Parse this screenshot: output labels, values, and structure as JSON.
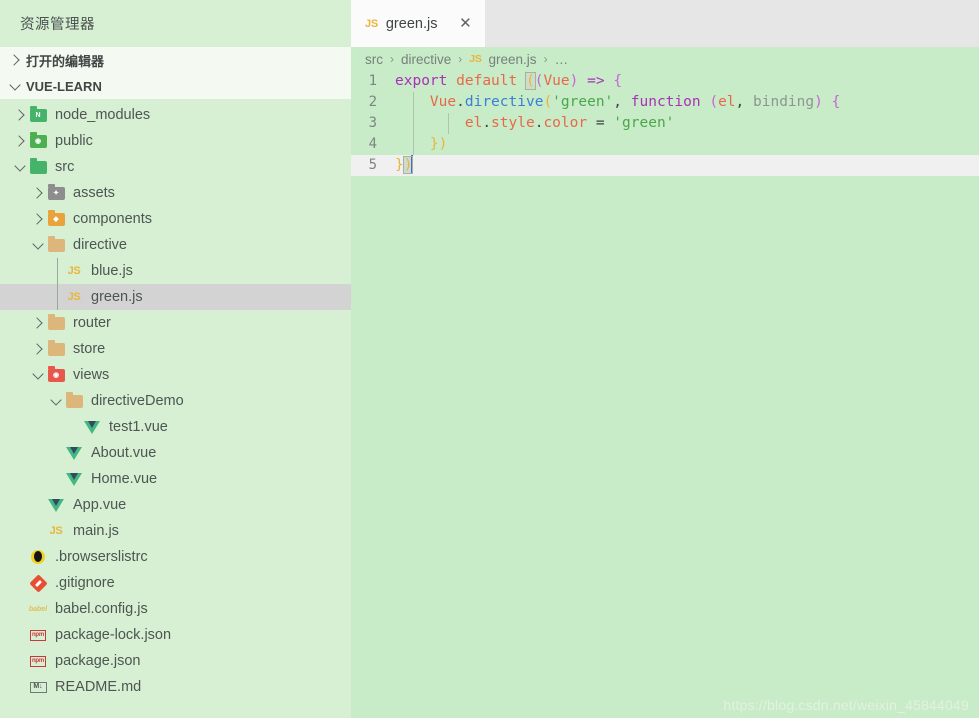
{
  "colors": {
    "editor_bg": "#c8ebc8",
    "sidebar_bg": "#d7efd3",
    "section_bg": "#f4faf2",
    "tabbar_bg": "#e6e6e6",
    "tab_active_bg": "#fbfbfb",
    "selection_bg": "#d3d3d3",
    "current_line_bg": "#f0f0f0",
    "cursor": "#4169e1",
    "watermark": "#e2f2e0"
  },
  "sidebar": {
    "title": "资源管理器",
    "sections": [
      {
        "label": "打开的编辑器",
        "expanded": false,
        "icon": "chevron-right-icon"
      },
      {
        "label": "VUE-LEARN",
        "expanded": true,
        "icon": "chevron-down-icon"
      }
    ],
    "tree": [
      {
        "label": "node_modules",
        "kind": "folder",
        "icon": "folder-node-icon",
        "twisty": "chevron-right-icon",
        "depth": 1,
        "selected": false
      },
      {
        "label": "public",
        "kind": "folder",
        "icon": "folder-public-icon",
        "twisty": "chevron-right-icon",
        "depth": 1,
        "selected": false
      },
      {
        "label": "src",
        "kind": "folder",
        "icon": "folder-src-icon",
        "twisty": "chevron-down-icon",
        "depth": 1,
        "selected": false
      },
      {
        "label": "assets",
        "kind": "folder",
        "icon": "folder-assets-icon",
        "twisty": "chevron-right-icon",
        "depth": 2,
        "selected": false
      },
      {
        "label": "components",
        "kind": "folder",
        "icon": "folder-components-icon",
        "twisty": "chevron-right-icon",
        "depth": 2,
        "selected": false
      },
      {
        "label": "directive",
        "kind": "folder",
        "icon": "folder-icon",
        "twisty": "chevron-down-icon",
        "depth": 2,
        "selected": false
      },
      {
        "label": "blue.js",
        "kind": "file",
        "icon": "js-file-icon",
        "twisty": "",
        "depth": 3,
        "selected": false
      },
      {
        "label": "green.js",
        "kind": "file",
        "icon": "js-file-icon",
        "twisty": "",
        "depth": 3,
        "selected": true
      },
      {
        "label": "router",
        "kind": "folder",
        "icon": "folder-icon",
        "twisty": "chevron-right-icon",
        "depth": 2,
        "selected": false
      },
      {
        "label": "store",
        "kind": "folder",
        "icon": "folder-icon",
        "twisty": "chevron-right-icon",
        "depth": 2,
        "selected": false
      },
      {
        "label": "views",
        "kind": "folder",
        "icon": "folder-views-icon",
        "twisty": "chevron-down-icon",
        "depth": 2,
        "selected": false
      },
      {
        "label": "directiveDemo",
        "kind": "folder",
        "icon": "folder-icon",
        "twisty": "chevron-down-icon",
        "depth": 3,
        "selected": false
      },
      {
        "label": "test1.vue",
        "kind": "file",
        "icon": "vue-file-icon",
        "twisty": "",
        "depth": 4,
        "selected": false
      },
      {
        "label": "About.vue",
        "kind": "file",
        "icon": "vue-file-icon",
        "twisty": "",
        "depth": 3,
        "selected": false
      },
      {
        "label": "Home.vue",
        "kind": "file",
        "icon": "vue-file-icon",
        "twisty": "",
        "depth": 3,
        "selected": false
      },
      {
        "label": "App.vue",
        "kind": "file",
        "icon": "vue-file-icon",
        "twisty": "",
        "depth": 2,
        "selected": false
      },
      {
        "label": "main.js",
        "kind": "file",
        "icon": "js-file-icon",
        "twisty": "",
        "depth": 2,
        "selected": false
      },
      {
        "label": ".browserslistrc",
        "kind": "file",
        "icon": "browserslist-icon",
        "twisty": "",
        "depth": 1,
        "selected": false
      },
      {
        "label": ".gitignore",
        "kind": "file",
        "icon": "git-icon",
        "twisty": "",
        "depth": 1,
        "selected": false
      },
      {
        "label": "babel.config.js",
        "kind": "file",
        "icon": "babel-icon",
        "twisty": "",
        "depth": 1,
        "selected": false
      },
      {
        "label": "package-lock.json",
        "kind": "file",
        "icon": "npm-icon",
        "twisty": "",
        "depth": 1,
        "selected": false
      },
      {
        "label": "package.json",
        "kind": "file",
        "icon": "npm-icon",
        "twisty": "",
        "depth": 1,
        "selected": false
      },
      {
        "label": "README.md",
        "kind": "file",
        "icon": "markdown-icon",
        "twisty": "",
        "depth": 1,
        "selected": false
      }
    ]
  },
  "editor": {
    "tabs": [
      {
        "label": "green.js",
        "icon": "js-file-icon",
        "active": true,
        "close_label": "✕"
      }
    ],
    "breadcrumb": {
      "items": [
        "src",
        "directive",
        "green.js",
        "…"
      ],
      "separator": "›",
      "file_icon": "js-file-icon"
    },
    "code": {
      "language": "javascript",
      "lines": [
        {
          "num": "1",
          "text": "export default ((Vue) => {",
          "current": false
        },
        {
          "num": "2",
          "text": "    Vue.directive('green', function (el, binding) {",
          "current": false
        },
        {
          "num": "3",
          "text": "        el.style.color = 'green'",
          "current": false
        },
        {
          "num": "4",
          "text": "    })",
          "current": false
        },
        {
          "num": "5",
          "text": "})",
          "current": true
        }
      ]
    }
  },
  "watermark": "https://blog.csdn.net/weixin_45844049"
}
